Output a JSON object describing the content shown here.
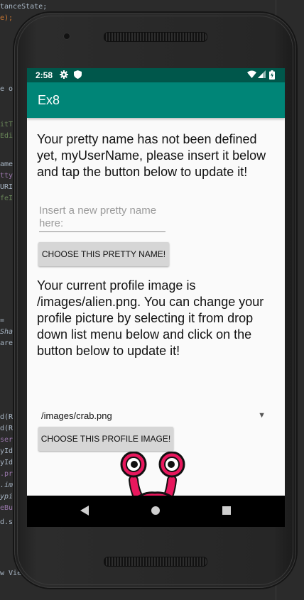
{
  "ide_code_lines": [
    "tanceState;",
    "e);",
    "e ou",
    "itTe",
    "Edit",
    "ame)",
    "ttyN",
    "URI)",
    "feIm",
    "=",
    "Shar",
    "ared",
    "d(R.",
    "d(R.",
    "serN",
    "yId(",
    "yId(",
    ".pre",
    ".ima",
    "ypin",
    "eBut",
    "d.s",
    "w Vie"
  ],
  "status_bar": {
    "time": "2:58",
    "icons": [
      "gear-icon",
      "shield-icon",
      "wifi-icon",
      "signal-icon",
      "battery-icon"
    ]
  },
  "app_bar": {
    "title": "Ex8"
  },
  "main": {
    "name_message": "Your pretty name has not been defined yet, myUserName, please insert it below and tap the button below to update it!",
    "name_input": {
      "placeholder": "Insert a new pretty name here:",
      "value": ""
    },
    "name_button_label": "CHOOSE THIS PRETTY NAME!",
    "image_message": "Your current profile image is /images/alien.png. You can change your profile picture by selecting it from drop down list menu below and click on the button below to update it!",
    "image_spinner": {
      "selected": "/images/crab.png",
      "icon": "dropdown-arrow-icon"
    },
    "image_button_label": "CHOOSE THIS PROFILE IMAGE!",
    "profile_image": "alien-monster-image"
  },
  "nav_bar": {
    "items": [
      "back-icon",
      "home-icon",
      "recents-icon"
    ]
  },
  "colors": {
    "status_bar": "#00574b",
    "app_bar": "#008577",
    "background": "#fafafa",
    "button": "#d6d6d6",
    "monster_body": "#e8175d",
    "monster_spots": "#d9a874"
  }
}
